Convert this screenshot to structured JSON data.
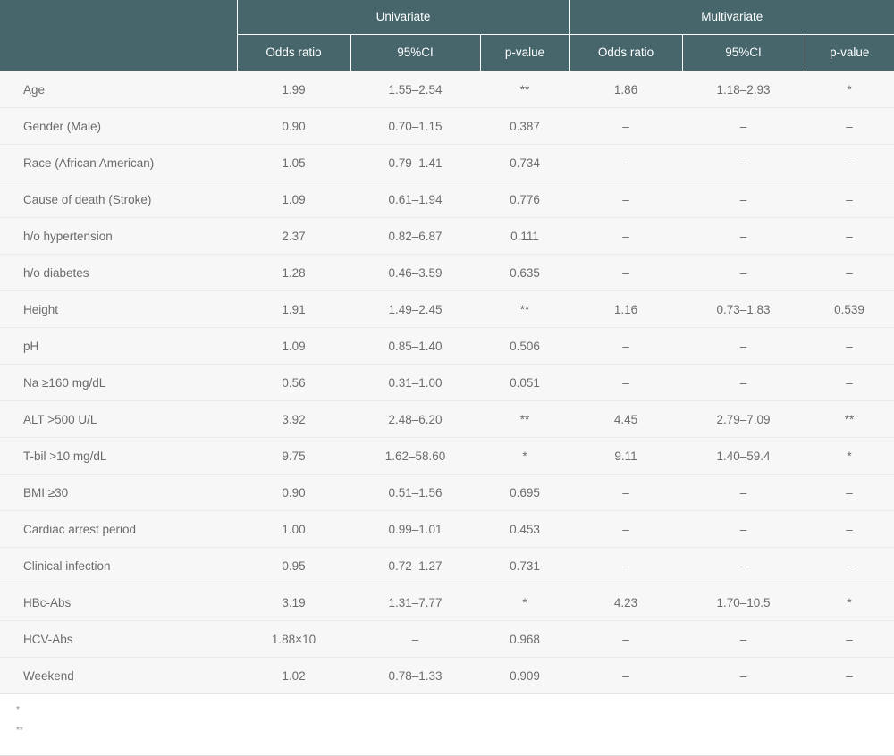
{
  "table": {
    "row_header_label": "",
    "groups": [
      {
        "label": "Univariate",
        "span": 3
      },
      {
        "label": "Multivariate",
        "span": 3
      }
    ],
    "subheaders": [
      "Odds ratio",
      "95%CI",
      "p-value",
      "Odds ratio",
      "95%CI",
      "p-value"
    ],
    "rows": [
      {
        "label": "Age",
        "uni_or": "1.99",
        "uni_ci": "1.55–2.54",
        "uni_p": "**",
        "multi_or": "1.86",
        "multi_ci": "1.18–2.93",
        "multi_p": "*"
      },
      {
        "label": "Gender (Male)",
        "uni_or": "0.90",
        "uni_ci": "0.70–1.15",
        "uni_p": "0.387",
        "multi_or": "–",
        "multi_ci": "–",
        "multi_p": "–"
      },
      {
        "label": "Race (African American)",
        "uni_or": "1.05",
        "uni_ci": "0.79–1.41",
        "uni_p": "0.734",
        "multi_or": "–",
        "multi_ci": "–",
        "multi_p": "–"
      },
      {
        "label": "Cause of death (Stroke)",
        "uni_or": "1.09",
        "uni_ci": "0.61–1.94",
        "uni_p": "0.776",
        "multi_or": "–",
        "multi_ci": "–",
        "multi_p": "–"
      },
      {
        "label": "h/o hypertension",
        "uni_or": "2.37",
        "uni_ci": "0.82–6.87",
        "uni_p": "0.111",
        "multi_or": "–",
        "multi_ci": "–",
        "multi_p": "–"
      },
      {
        "label": "h/o diabetes",
        "uni_or": "1.28",
        "uni_ci": "0.46–3.59",
        "uni_p": "0.635",
        "multi_or": "–",
        "multi_ci": "–",
        "multi_p": "–"
      },
      {
        "label": "Height",
        "uni_or": "1.91",
        "uni_ci": "1.49–2.45",
        "uni_p": "**",
        "multi_or": "1.16",
        "multi_ci": "0.73–1.83",
        "multi_p": "0.539"
      },
      {
        "label": "pH",
        "uni_or": "1.09",
        "uni_ci": "0.85–1.40",
        "uni_p": "0.506",
        "multi_or": "–",
        "multi_ci": "–",
        "multi_p": "–"
      },
      {
        "label": "Na ≥160 mg/dL",
        "uni_or": "0.56",
        "uni_ci": "0.31–1.00",
        "uni_p": "0.051",
        "multi_or": "–",
        "multi_ci": "–",
        "multi_p": "–"
      },
      {
        "label": "ALT >500 U/L",
        "uni_or": "3.92",
        "uni_ci": "2.48–6.20",
        "uni_p": "**",
        "multi_or": "4.45",
        "multi_ci": "2.79–7.09",
        "multi_p": "**"
      },
      {
        "label": "T-bil >10 mg/dL",
        "uni_or": "9.75",
        "uni_ci": "1.62–58.60",
        "uni_p": "*",
        "multi_or": "9.11",
        "multi_ci": "1.40–59.4",
        "multi_p": "*"
      },
      {
        "label": "BMI ≥30",
        "uni_or": "0.90",
        "uni_ci": "0.51–1.56",
        "uni_p": "0.695",
        "multi_or": "–",
        "multi_ci": "–",
        "multi_p": "–"
      },
      {
        "label": "Cardiac arrest period",
        "uni_or": "1.00",
        "uni_ci": "0.99–1.01",
        "uni_p": "0.453",
        "multi_or": "–",
        "multi_ci": "–",
        "multi_p": "–"
      },
      {
        "label": "Clinical infection",
        "uni_or": "0.95",
        "uni_ci": "0.72–1.27",
        "uni_p": "0.731",
        "multi_or": "–",
        "multi_ci": "–",
        "multi_p": "–"
      },
      {
        "label": "HBc-Abs",
        "uni_or": "3.19",
        "uni_ci": "1.31–7.77",
        "uni_p": "*",
        "multi_or": "4.23",
        "multi_ci": "1.70–10.5",
        "multi_p": "*"
      },
      {
        "label": "HCV-Abs",
        "uni_or": "1.88×10",
        "uni_ci": "–",
        "uni_p": "0.968",
        "multi_or": "–",
        "multi_ci": "–",
        "multi_p": "–"
      },
      {
        "label": "Weekend",
        "uni_or": "1.02",
        "uni_ci": "0.78–1.33",
        "uni_p": "0.909",
        "multi_or": "–",
        "multi_ci": "–",
        "multi_p": "–"
      }
    ]
  },
  "footnotes": [
    {
      "mark": "*",
      "text": ""
    },
    {
      "mark": "**",
      "text": ""
    }
  ],
  "colors": {
    "header_bg": "#46666c",
    "header_text": "#ffffff",
    "row_bg": "#f7f7f7",
    "body_text": "#6b6b6b",
    "page_bg": "#ffffff"
  }
}
